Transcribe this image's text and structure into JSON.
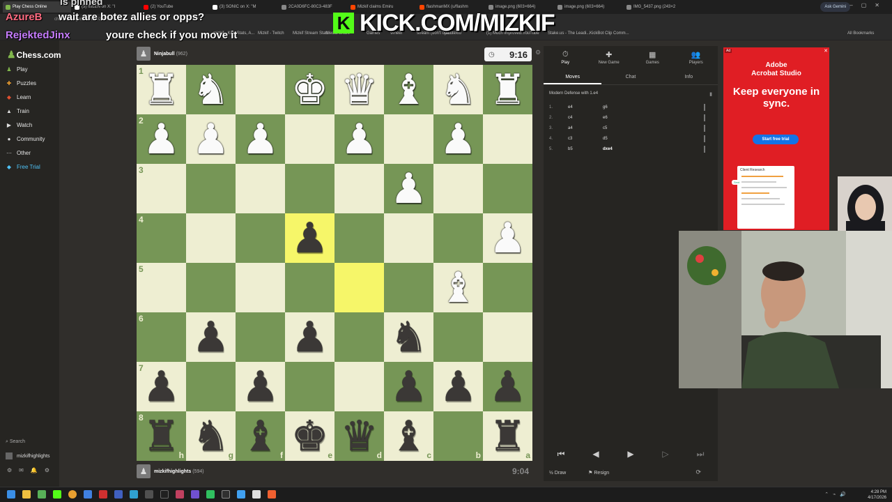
{
  "browser": {
    "tabs": [
      {
        "title": "Play Chess Online",
        "color": "#81b64c",
        "active": true
      },
      {
        "title": "(3) ItsLEN on X: \"I",
        "color": "#ffffff"
      },
      {
        "title": "(2) YouTube",
        "color": "#ff0000"
      },
      {
        "title": "(3) SONIC on X: \"M",
        "color": "#ffffff"
      },
      {
        "title": "2CA0D6FC-80C3-483F",
        "color": "#888888"
      },
      {
        "title": "Mizkif claims Emiru",
        "color": "#ff4500"
      },
      {
        "title": "flashmanMX (u/flashm",
        "color": "#ff4500"
      },
      {
        "title": "image.png (603×664)",
        "color": "#888888"
      },
      {
        "title": "image.png (603×664)",
        "color": "#888888"
      },
      {
        "title": "IMG_5437.png (243×2",
        "color": "#888888"
      }
    ],
    "ask_gemini": "Ask Gemini",
    "url": "chess.com/game/167402c2296",
    "bookmarks": [
      "mizkif - Kick Stats, A...",
      "Mizkif - Twitch",
      "Mizkif Stream Stats",
      "Media Share",
      "Games",
      "Wheel",
      "stream (don't ope...",
      "Contexto",
      "(1) Much improved...",
      "YouTube",
      "Stake.us - The Leadi...",
      "KickBot Clip Comm...",
      "All Bookmarks"
    ]
  },
  "overlay": {
    "kick_logo": "K",
    "kick_url": "KICK.COM/MIZKIF",
    "chat_lines": [
      {
        "text": "is pinned",
        "color": "#dddddd"
      },
      {
        "text": "AzureB",
        "color": "#ff6b81"
      },
      {
        "text": "wait are botez allies or opps?",
        "color": "#ffffff"
      },
      {
        "text": "RejektedJinx",
        "color": "#c77dff"
      },
      {
        "text": "youre check if you move it",
        "color": "#ffffff"
      }
    ]
  },
  "sidebar": {
    "logo": "Chess.com",
    "items": [
      {
        "label": "Play",
        "icon": "play-icon",
        "glyph": "♟",
        "color": "#81b64c"
      },
      {
        "label": "Puzzles",
        "icon": "puzzle-icon",
        "glyph": "✚",
        "color": "#f0a030"
      },
      {
        "label": "Learn",
        "icon": "learn-icon",
        "glyph": "◆",
        "color": "#e05030"
      },
      {
        "label": "Train",
        "icon": "train-icon",
        "glyph": "▲",
        "color": "#dddddd"
      },
      {
        "label": "Watch",
        "icon": "watch-icon",
        "glyph": "▶",
        "color": "#dddddd"
      },
      {
        "label": "Community",
        "icon": "community-icon",
        "glyph": "●",
        "color": "#dddddd"
      },
      {
        "label": "Other",
        "icon": "more-icon",
        "glyph": "⋯",
        "color": "#dddddd"
      },
      {
        "label": "Free Trial",
        "icon": "diamond-icon",
        "glyph": "◆",
        "color": "#4fc3f7"
      }
    ],
    "search_label": "Search",
    "username": "mizkifhighlights"
  },
  "game": {
    "top_player": {
      "name": "Ninjabull",
      "rating": "(962)",
      "clock": "9:16"
    },
    "bottom_player": {
      "name": "mizkifhighlights",
      "rating": "(594)",
      "clock": "9:04"
    },
    "file_labels": [
      "h",
      "g",
      "f",
      "e",
      "d",
      "c",
      "b",
      "a"
    ],
    "rank_labels": [
      "1",
      "2",
      "3",
      "4",
      "5",
      "6",
      "7",
      "8"
    ],
    "board": [
      [
        "wR",
        "wN",
        "",
        "wK",
        "wQ",
        "wB",
        "wN",
        "wR"
      ],
      [
        "wP",
        "wP",
        "wP",
        "",
        "wP",
        "",
        "wP",
        ""
      ],
      [
        "",
        "",
        "",
        "",
        "",
        "wP",
        "",
        ""
      ],
      [
        "",
        "",
        "",
        "bP",
        "",
        "",
        "",
        "wP"
      ],
      [
        "",
        "",
        "",
        "",
        "",
        "",
        "wB",
        ""
      ],
      [
        "",
        "bP",
        "",
        "bP",
        "",
        "bN",
        "",
        ""
      ],
      [
        "bP",
        "",
        "bP",
        "",
        "",
        "bP",
        "bP",
        "bP"
      ],
      [
        "bR",
        "bN",
        "bB",
        "bK",
        "bQ",
        "bB",
        "",
        "bR"
      ]
    ],
    "highlighted": [
      "3-3",
      "4-4"
    ]
  },
  "panel": {
    "tabs": [
      {
        "label": "Play",
        "icon": "clock-icon",
        "glyph": "⏱"
      },
      {
        "label": "New Game",
        "icon": "plus-icon",
        "glyph": "✚"
      },
      {
        "label": "Games",
        "icon": "grid-icon",
        "glyph": "▦"
      },
      {
        "label": "Players",
        "icon": "players-icon",
        "glyph": "👥"
      }
    ],
    "subtabs": [
      "Moves",
      "Chat",
      "Info"
    ],
    "opening": "Modern Defense with 1.e4",
    "moves": [
      {
        "num": "1.",
        "white": "e4",
        "black": "g6"
      },
      {
        "num": "2.",
        "white": "c4",
        "black": "e6"
      },
      {
        "num": "3.",
        "white": "a4",
        "black": "c5"
      },
      {
        "num": "4.",
        "white": "c3",
        "black": "d5"
      },
      {
        "num": "5.",
        "white": "b5",
        "black": "dxe4"
      }
    ],
    "draw_label": "Draw",
    "resign_label": "Resign"
  },
  "ad": {
    "tag": "Ad",
    "brand": "Adobe\nAcrobat Studio",
    "headline": "Keep everyone in sync.",
    "cta": "Start free trial",
    "doc_title": "Client Research",
    "badge": "Sent"
  },
  "taskbar": {
    "time": "4:28 PM",
    "date": "4/17/2026"
  }
}
